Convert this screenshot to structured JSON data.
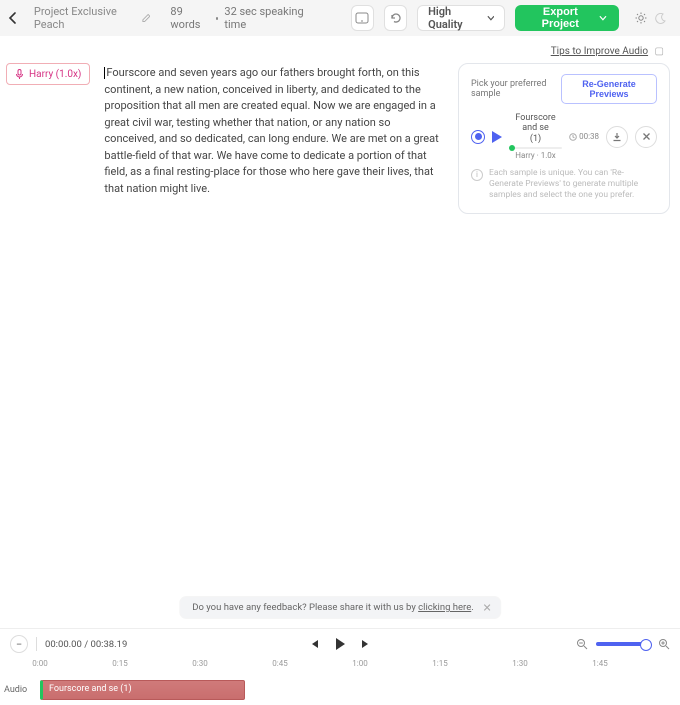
{
  "topbar": {
    "title": "Project Exclusive Peach",
    "words": "89 words",
    "speaking_time": "32 sec speaking time",
    "quality_label": "High Quality",
    "export_label": "Export Project"
  },
  "tips": {
    "label": "Tips to Improve Audio"
  },
  "voice_tag": {
    "label": "Harry (1.0x)"
  },
  "editor": {
    "text": "Fourscore and seven years ago our fathers brought forth, on this continent, a new nation, conceived in liberty, and dedicated to the proposition that all men are created equal. Now we are engaged in a great civil war, testing whether that nation, or any nation so conceived, and so dedicated, can long endure. We are met on a great battle-field of that war. We have come to dedicate a portion of that field, as a final resting-place for those who here gave their lives, that that nation might live."
  },
  "preview": {
    "pick_label": "Pick your preferred sample",
    "regen_label": "Re-Generate Previews",
    "sample": {
      "title": "Fourscore and se",
      "index": "(1)",
      "duration": "00:38",
      "subtitle": "Harry · 1.0x"
    },
    "info": "Each sample is unique. You can 'Re-Generate Previews' to generate multiple samples and select the one you prefer."
  },
  "feedback": {
    "text_prefix": "Do you have any feedback? Please share it with us by ",
    "link": "clicking here",
    "text_suffix": "."
  },
  "transport": {
    "current": "00:00.00",
    "sep": " / ",
    "total": "00:38.19"
  },
  "ruler": {
    "ticks": [
      "0:00",
      "0:15",
      "0:30",
      "0:45",
      "1:00",
      "1:15",
      "1:30",
      "1:45"
    ]
  },
  "track": {
    "label": "Audio",
    "clip_label": "Fourscore and se (1)"
  }
}
